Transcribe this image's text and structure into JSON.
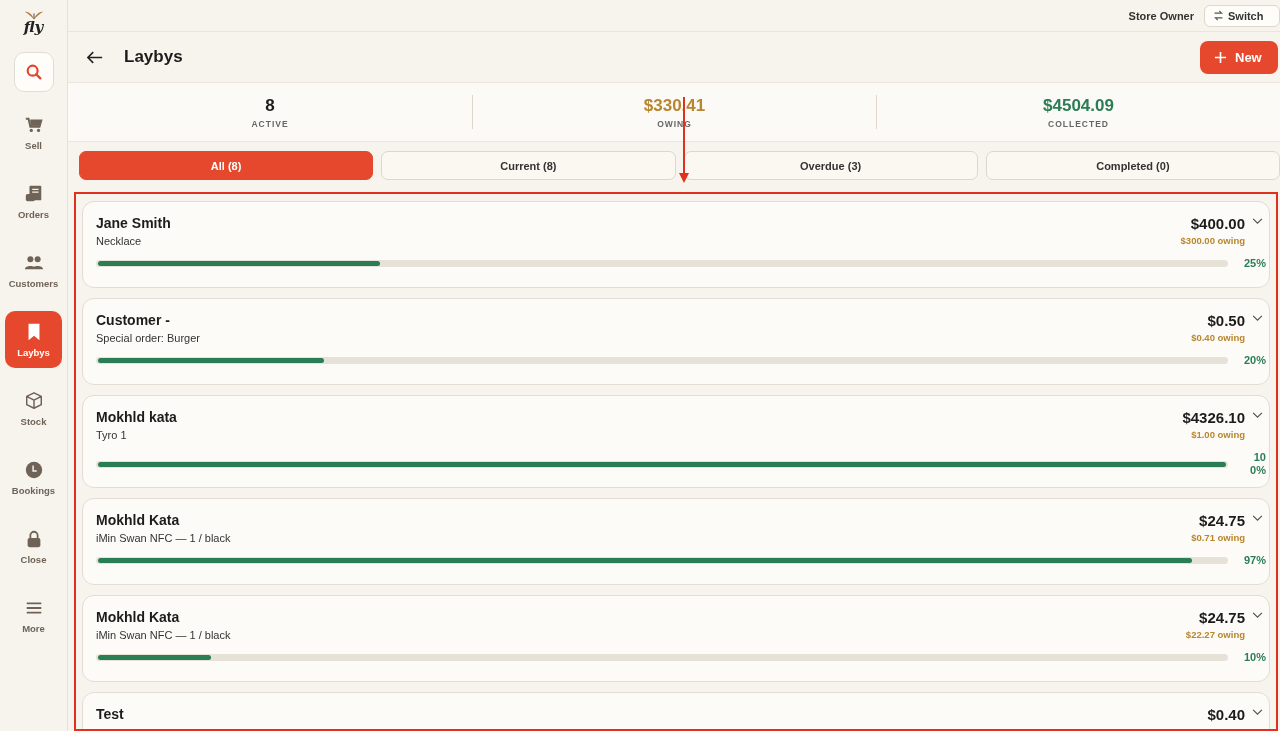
{
  "sidebar": {
    "logo": "fly",
    "items": [
      {
        "label": "Sell",
        "selected": false
      },
      {
        "label": "Orders",
        "selected": false
      },
      {
        "label": "Customers",
        "selected": false
      },
      {
        "label": "Laybys",
        "selected": true
      },
      {
        "label": "Stock",
        "selected": false
      },
      {
        "label": "Bookings",
        "selected": false
      },
      {
        "label": "Close",
        "selected": false
      },
      {
        "label": "More",
        "selected": false
      }
    ]
  },
  "top_bar": {
    "user": "Store Owner",
    "switch_button": "Switch"
  },
  "header": {
    "title": "Laybys",
    "new_button": "New"
  },
  "stats": [
    {
      "value": "8",
      "label": "ACTIVE"
    },
    {
      "value": "$330.41",
      "label": "OWING"
    },
    {
      "value": "$4504.09",
      "label": "COLLECTED"
    }
  ],
  "tabs": [
    {
      "label": "All (8)",
      "selected": true
    },
    {
      "label": "Current (8)",
      "selected": false
    },
    {
      "label": "Overdue (3)",
      "selected": false
    },
    {
      "label": "Completed (0)",
      "selected": false
    }
  ],
  "laybys": [
    {
      "name": "Jane Smith",
      "item": "Necklace",
      "total": "$400.00",
      "owing": "$300.00 owing",
      "level": 0.25,
      "percent": "25%"
    },
    {
      "name": "Customer -",
      "item": "Special order: Burger",
      "total": "$0.50",
      "owing": "$0.40 owing",
      "level": 0.2,
      "percent": "20%"
    },
    {
      "name": "Mokhld kata",
      "item": "Tyro 1",
      "total": "$4326.10",
      "owing": "$1.00 owing",
      "level": 1.0,
      "percent": "100%"
    },
    {
      "name": "Mokhld Kata",
      "item": "iMin Swan NFC — 1 / black",
      "total": "$24.75",
      "owing": "$0.71 owing",
      "level": 0.97,
      "percent": "97%"
    },
    {
      "name": "Mokhld Kata",
      "item": "iMin Swan NFC — 1 / black",
      "total": "$24.75",
      "owing": "$22.27 owing",
      "level": 0.1,
      "percent": "10%"
    },
    {
      "name": "Test",
      "total": "$0.40"
    }
  ],
  "annotation": {
    "arrow": true,
    "highlight_box": true
  }
}
